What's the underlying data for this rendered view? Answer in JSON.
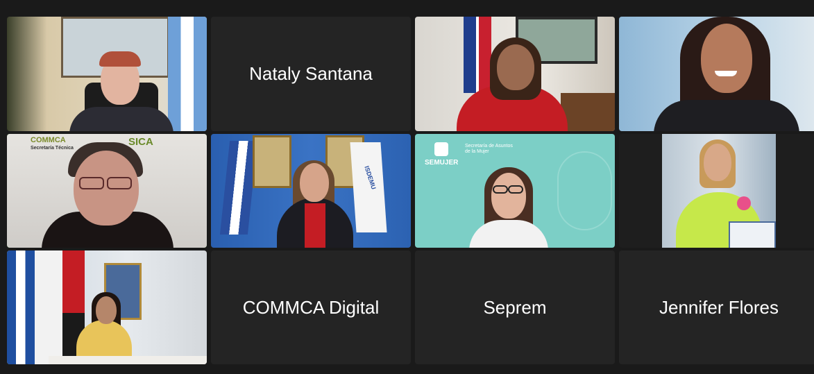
{
  "participants": [
    {
      "name": "",
      "video": true
    },
    {
      "name": "Nataly Santana",
      "video": false
    },
    {
      "name": "",
      "video": true
    },
    {
      "name": "",
      "video": true
    },
    {
      "name": "",
      "video": true,
      "active_speaker": true
    },
    {
      "name": "",
      "video": true
    },
    {
      "name": "",
      "video": true
    },
    {
      "name": "",
      "video": true
    },
    {
      "name": "",
      "video": true
    },
    {
      "name": "COMMCA Digital",
      "video": false
    },
    {
      "name": "Seprem",
      "video": false
    },
    {
      "name": "Jennifer Flores",
      "video": false
    }
  ],
  "backgrounds": {
    "commca": "COMMCA",
    "secretaria": "Secretaría Técnica",
    "sica": "SICA",
    "semujer": "SEMUJER",
    "semujer_sub": "Secretaría de Asuntos de la Mujer",
    "isdemu": "ISDEMU"
  },
  "colors": {
    "active_border": "#4fc13b",
    "tile_bg": "#242424",
    "page_bg": "#1a1a1a"
  }
}
